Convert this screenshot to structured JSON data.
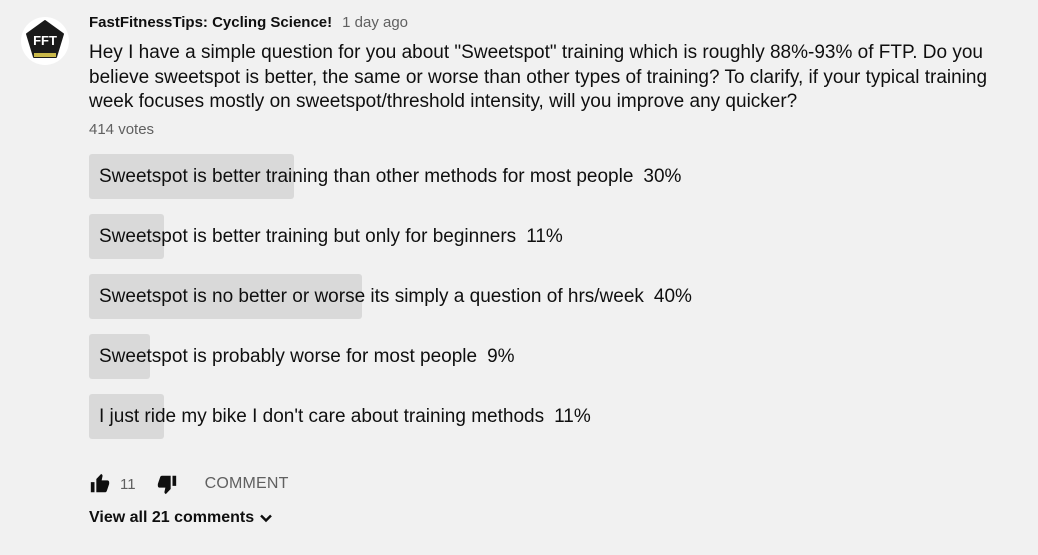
{
  "post": {
    "author": "FastFitnessTips: Cycling Science!",
    "time": "1 day ago",
    "avatar_text": "FFT",
    "question": "Hey I have a simple question for you about \"Sweetspot\" training which is roughly 88%-93% of FTP. Do you believe sweetspot is better, the same or worse than other types of training? To clarify, if your typical training week focuses mostly on sweetspot/threshold intensity, will you improve any quicker?",
    "votes": "414 votes"
  },
  "poll": {
    "options": [
      {
        "label": "Sweetspot is better training than other methods for most people",
        "percent_text": "30%",
        "percent": 30
      },
      {
        "label": "Sweetspot is better training but only for beginners",
        "percent_text": "11%",
        "percent": 11
      },
      {
        "label": "Sweetspot is no better or worse its simply a question of hrs/week",
        "percent_text": "40%",
        "percent": 40
      },
      {
        "label": "Sweetspot is probably worse for most people",
        "percent_text": "9%",
        "percent": 9
      },
      {
        "label": "I just ride my bike I don't care about training methods",
        "percent_text": "11%",
        "percent": 11
      }
    ]
  },
  "actions": {
    "like_count": "11",
    "comment_label": "COMMENT",
    "like_icon": "thumbs-up-icon",
    "dislike_icon": "thumbs-down-icon"
  },
  "comments": {
    "view_all_label": "View all 21 comments"
  }
}
